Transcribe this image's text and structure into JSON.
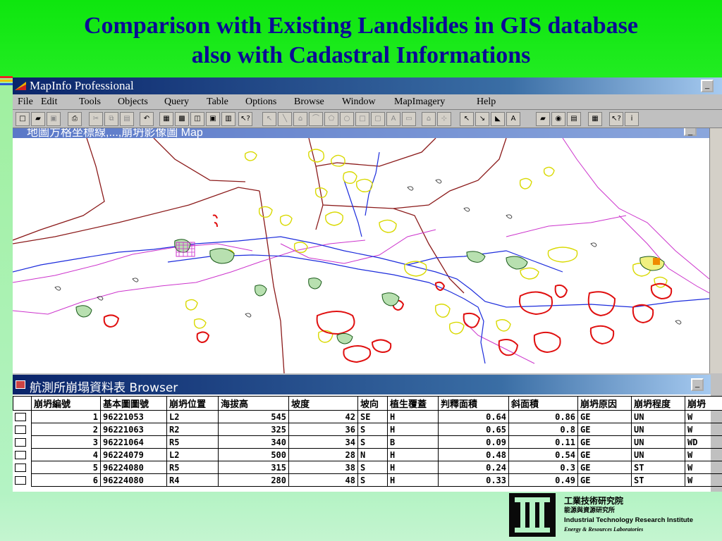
{
  "slide": {
    "title_line1": "Comparison with Existing Landslides in GIS database",
    "title_line2": "also with Cadastral Informations"
  },
  "app": {
    "title": "MapInfo Professional",
    "menu": [
      "File",
      "Edit",
      "Tools",
      "Objects",
      "Query",
      "Table",
      "Options",
      "Browse",
      "Window",
      "MapImagery",
      "Help"
    ]
  },
  "map_window": {
    "title": "地圖方格坐標線,...,崩坍影像圖 Map"
  },
  "browser": {
    "title": "航測所崩塌資料表 Browser",
    "columns": [
      "崩坍編號",
      "基本圖圖號",
      "崩坍位置",
      "海拔高",
      "坡度",
      "坡向",
      "植生覆蓋",
      "判釋面積",
      "斜面積",
      "崩坍原因",
      "崩坍程度",
      "崩坍"
    ],
    "rows": [
      [
        "1",
        "96221053",
        "L2",
        "545",
        "42",
        "SE",
        "H",
        "0.64",
        "0.86",
        "GE",
        "UN",
        "W"
      ],
      [
        "2",
        "96221063",
        "R2",
        "325",
        "36",
        "S",
        "H",
        "0.65",
        "0.8",
        "GE",
        "UN",
        "W"
      ],
      [
        "3",
        "96221064",
        "R5",
        "340",
        "34",
        "S",
        "B",
        "0.09",
        "0.11",
        "GE",
        "UN",
        "WD"
      ],
      [
        "4",
        "96224079",
        "L2",
        "500",
        "28",
        "N",
        "H",
        "0.48",
        "0.54",
        "GE",
        "UN",
        "W"
      ],
      [
        "5",
        "96224080",
        "R5",
        "315",
        "38",
        "S",
        "H",
        "0.24",
        "0.3",
        "GE",
        "ST",
        "W"
      ],
      [
        "6",
        "96224080",
        "R4",
        "280",
        "48",
        "S",
        "H",
        "0.33",
        "0.49",
        "GE",
        "ST",
        "W"
      ]
    ]
  },
  "logo": {
    "zh_line1": "工業技術研究院",
    "zh_line2": "能源與資源研究所",
    "en_line1": "Industrial Technology Research Institute",
    "en_line2": "Energy & Resources Laboratories"
  },
  "colors": {
    "slide_bg": "#22ec22",
    "title_text": "#0b0b96",
    "cadastral_line": "#8b1a1a",
    "landslide_existing": "#e01010",
    "landslide_new": "#e8e800",
    "river": "#1c2cdc",
    "road": "#cc33cc"
  }
}
